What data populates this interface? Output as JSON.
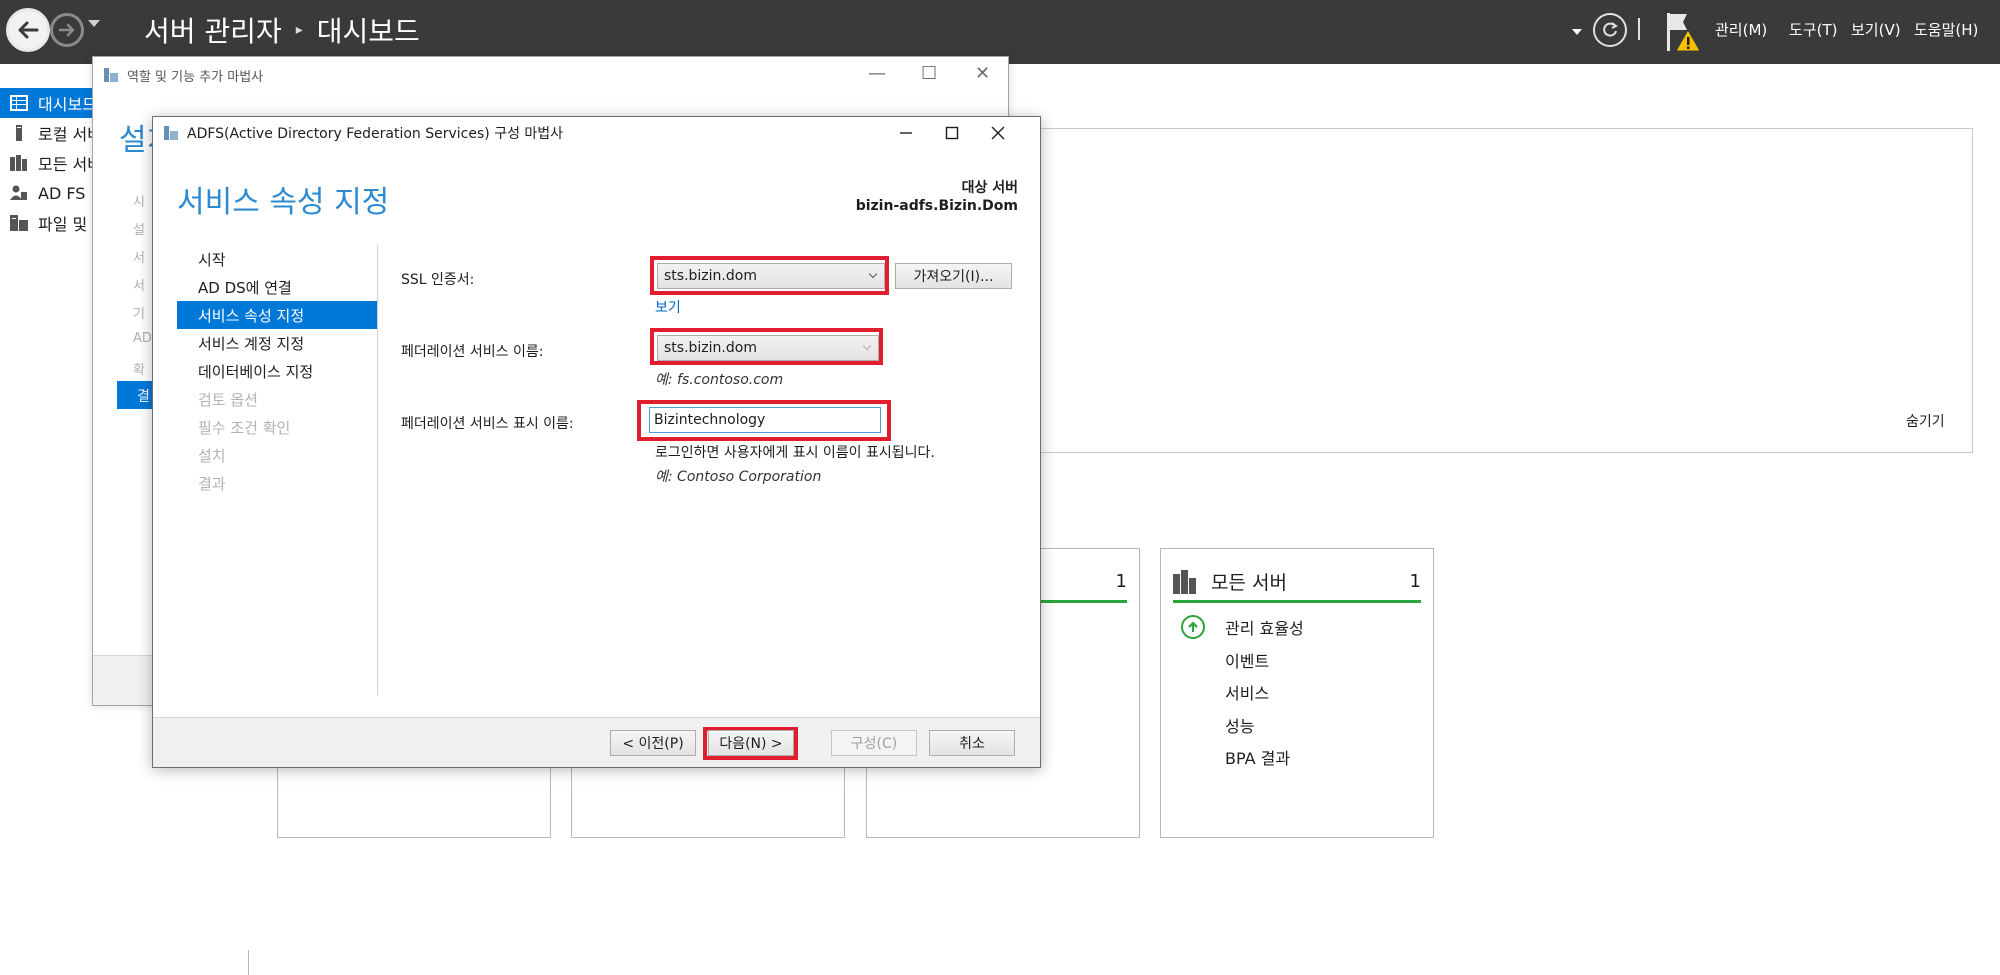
{
  "server_manager": {
    "breadcrumb_root": "서버 관리자",
    "breadcrumb_sep": "▸",
    "breadcrumb_current": "대시보드",
    "menus": [
      "관리(M)",
      "도구(T)",
      "보기(V)",
      "도움말(H)"
    ],
    "nav_items": [
      {
        "label": "대시보드",
        "icon": "dashboard-icon",
        "active": true
      },
      {
        "label": "로컬 서버",
        "icon": "local-server-icon"
      },
      {
        "label": "모든 서버",
        "icon": "all-servers-icon"
      },
      {
        "label": "AD FS",
        "icon": "adfs-role-icon"
      },
      {
        "label": "파일 및 저장소 서비스",
        "icon": "file-storage-icon"
      }
    ],
    "hide_label": "숨기기",
    "tiles": [
      {
        "name": "",
        "count": ""
      },
      {
        "name": "",
        "count": ""
      },
      {
        "name": "",
        "count": "1"
      },
      {
        "name": "모든 서버",
        "count": "1",
        "items": [
          "관리 효율성",
          "이벤트",
          "서비스",
          "성능",
          "BPA 결과"
        ]
      }
    ]
  },
  "bg_wizard": {
    "title": "역할 및 기능 추가 마법사",
    "heading_partial": "설치",
    "side_stubs": [
      "시",
      "설",
      "서",
      "서",
      "기",
      "AD",
      "확"
    ],
    "side_active": "결"
  },
  "adfs_wizard": {
    "title": "ADFS(Active Directory Federation Services) 구성 마법사",
    "heading": "서비스 속성 지정",
    "target_label": "대상 서버",
    "target_server": "bizin-adfs.Bizin.Dom",
    "steps": [
      {
        "label": "시작",
        "state": "normal"
      },
      {
        "label": "AD DS에 연결",
        "state": "normal"
      },
      {
        "label": "서비스 속성 지정",
        "state": "active"
      },
      {
        "label": "서비스 계정 지정",
        "state": "normal"
      },
      {
        "label": "데이터베이스 지정",
        "state": "normal"
      },
      {
        "label": "검토 옵션",
        "state": "disabled"
      },
      {
        "label": "필수 조건 확인",
        "state": "disabled"
      },
      {
        "label": "설치",
        "state": "disabled"
      },
      {
        "label": "결과",
        "state": "disabled"
      }
    ],
    "ssl_label": "SSL 인증서:",
    "ssl_value": "sts.bizin.dom",
    "import_button": "가져오기(I)...",
    "view_link": "보기",
    "fed_name_label": "페더레이션 서비스 이름:",
    "fed_name_value": "sts.bizin.dom",
    "fed_name_example": "예: fs.contoso.com",
    "display_name_label": "페더레이션 서비스 표시 이름:",
    "display_name_value": "Bizintechnology",
    "display_name_note": "로그인하면 사용자에게 표시 이름이 표시됩니다.",
    "display_name_example": "예: Contoso Corporation",
    "buttons": {
      "prev": "< 이전(P)",
      "next": "다음(N) >",
      "configure": "구성(C)",
      "cancel": "취소"
    },
    "highlight_color": "#e01e2d",
    "accent_color": "#0078d7"
  }
}
